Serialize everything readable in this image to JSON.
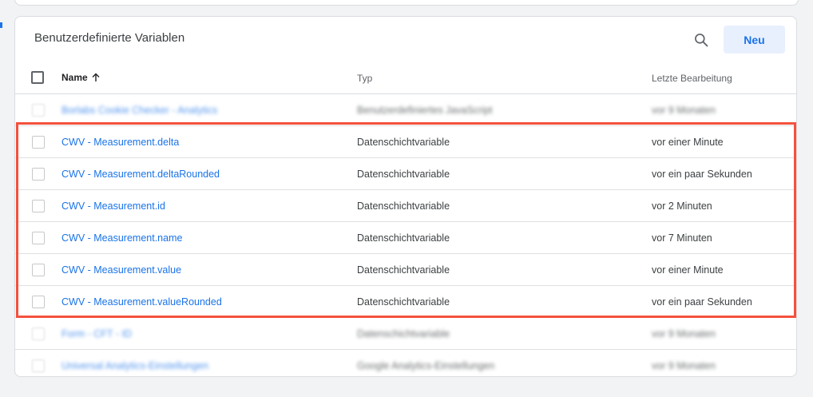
{
  "card": {
    "title": "Benutzerdefinierte Variablen",
    "new_button_label": "Neu"
  },
  "columns": {
    "name": "Name",
    "type": "Typ",
    "last_edit": "Letzte Bearbeitung"
  },
  "colors": {
    "highlight": "#f4513d",
    "link": "#1a73e8",
    "accent_bg": "#e8f0fe"
  },
  "rows": [
    {
      "name": "Borlabs Cookie Checker - Analytics",
      "type": "Benutzerdefiniertes JavaScript",
      "last_edit": "vor 9 Monaten",
      "blurred": true
    },
    {
      "name": "CWV - Measurement.delta",
      "type": "Datenschichtvariable",
      "last_edit": "vor einer Minute",
      "blurred": false
    },
    {
      "name": "CWV - Measurement.deltaRounded",
      "type": "Datenschichtvariable",
      "last_edit": "vor ein paar Sekunden",
      "blurred": false
    },
    {
      "name": "CWV - Measurement.id",
      "type": "Datenschichtvariable",
      "last_edit": "vor 2 Minuten",
      "blurred": false
    },
    {
      "name": "CWV - Measurement.name",
      "type": "Datenschichtvariable",
      "last_edit": "vor 7 Minuten",
      "blurred": false
    },
    {
      "name": "CWV - Measurement.value",
      "type": "Datenschichtvariable",
      "last_edit": "vor einer Minute",
      "blurred": false
    },
    {
      "name": "CWV - Measurement.valueRounded",
      "type": "Datenschichtvariable",
      "last_edit": "vor ein paar Sekunden",
      "blurred": false
    },
    {
      "name": "Form - CFT - ID",
      "type": "Datenschichtvariable",
      "last_edit": "vor 9 Monaten",
      "blurred": true
    },
    {
      "name": "Universal Analytics-Einstellungen",
      "type": "Google Analytics-Einstellungen",
      "last_edit": "vor 9 Monaten",
      "blurred": true
    }
  ]
}
